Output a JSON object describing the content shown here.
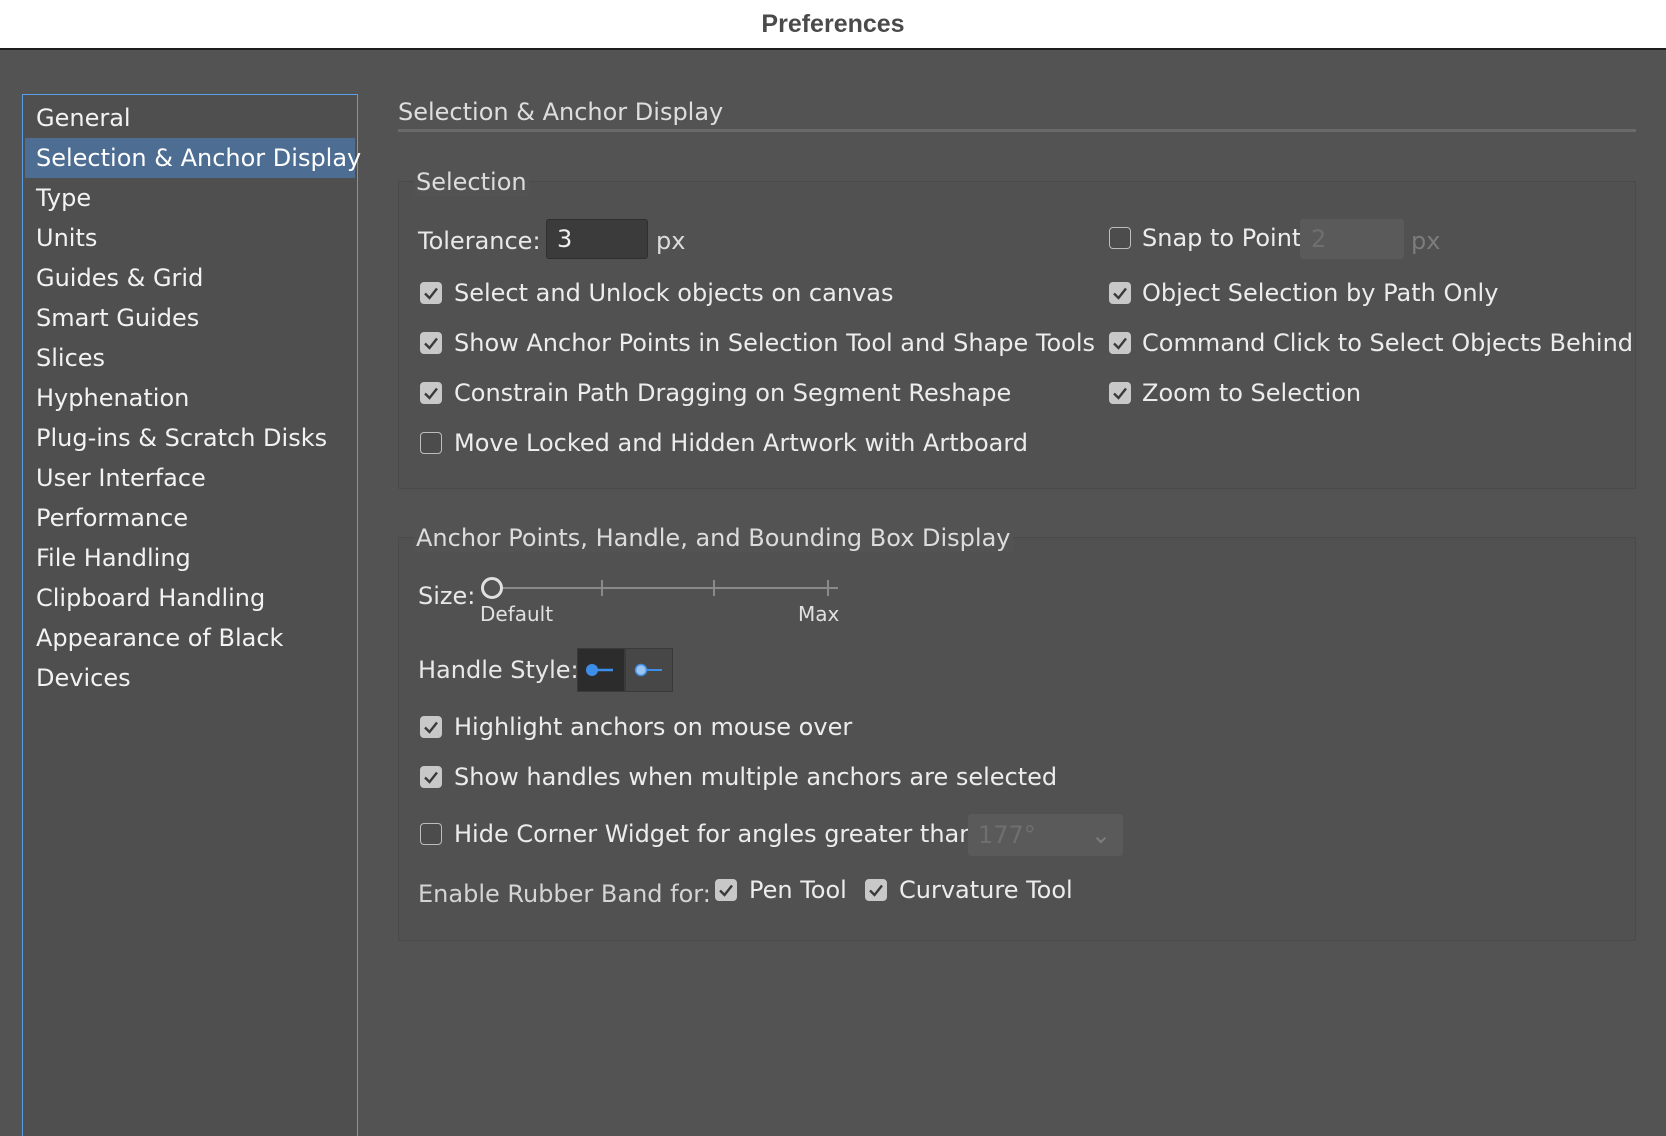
{
  "window": {
    "title": "Preferences"
  },
  "sidebar": {
    "items": [
      {
        "label": "General"
      },
      {
        "label": "Selection & Anchor Display",
        "active": true
      },
      {
        "label": "Type"
      },
      {
        "label": "Units"
      },
      {
        "label": "Guides & Grid"
      },
      {
        "label": "Smart Guides"
      },
      {
        "label": "Slices"
      },
      {
        "label": "Hyphenation"
      },
      {
        "label": "Plug-ins & Scratch Disks"
      },
      {
        "label": "User Interface"
      },
      {
        "label": "Performance"
      },
      {
        "label": "File Handling"
      },
      {
        "label": "Clipboard Handling"
      },
      {
        "label": "Appearance of Black"
      },
      {
        "label": "Devices"
      }
    ]
  },
  "panel": {
    "title": "Selection & Anchor Display"
  },
  "selection": {
    "group_label": "Selection",
    "tolerance_label": "Tolerance:",
    "tolerance_value": "3",
    "tolerance_unit": "px",
    "snap_label": "Snap to Point",
    "snap_checked": false,
    "snap_value": "2",
    "snap_unit": "px",
    "options": [
      {
        "label": "Select and Unlock objects on canvas",
        "checked": true
      },
      {
        "label": "Show Anchor Points in Selection Tool and Shape Tools",
        "checked": true
      },
      {
        "label": "Constrain Path Dragging on Segment Reshape",
        "checked": true
      },
      {
        "label": "Move Locked and Hidden Artwork with Artboard",
        "checked": false
      }
    ],
    "right_options": [
      {
        "label": "Object Selection by Path Only",
        "checked": true
      },
      {
        "label": "Command Click to Select Objects Behind",
        "checked": true
      },
      {
        "label": "Zoom to Selection",
        "checked": true
      }
    ]
  },
  "anchors": {
    "group_label": "Anchor Points, Handle, and Bounding Box Display",
    "size_label": "Size:",
    "size_min_label": "Default",
    "size_max_label": "Max",
    "size_level": 0,
    "handle_style_label": "Handle Style:",
    "options": [
      {
        "label": "Highlight anchors on mouse over",
        "checked": true
      },
      {
        "label": "Show handles when multiple anchors are selected",
        "checked": true
      },
      {
        "label": "Hide Corner Widget for angles greater than:",
        "checked": false
      }
    ],
    "corner_angle_value": "177°",
    "rubber_band_label": "Enable Rubber Band for:",
    "pen_tool_label": "Pen Tool",
    "pen_tool_checked": true,
    "curvature_tool_label": "Curvature Tool",
    "curvature_tool_checked": true
  },
  "colors": {
    "accent": "#5b9ee8",
    "selected_item": "#4d6d93",
    "handle_blue": "#3d8ee8"
  }
}
